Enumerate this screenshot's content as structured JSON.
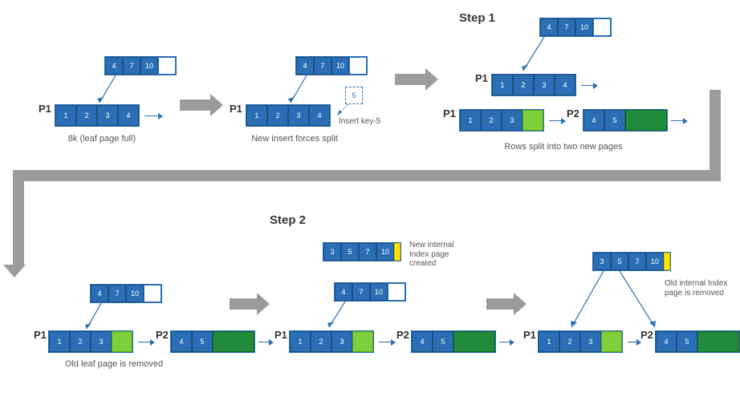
{
  "steps": {
    "s1": "Step 1",
    "s2": "Step 2"
  },
  "labels": {
    "p1": "P1",
    "p2": "P2"
  },
  "captions": {
    "c1": "8k (leaf page full)",
    "c2": "New insert forces split",
    "c3": "Rows split into two new pages",
    "c4": "Old leaf page is removed",
    "c5": "New internal Index page created",
    "c6": "Old internal Index page is removed"
  },
  "annot": {
    "ins": "Insert key-5"
  },
  "idx_a": {
    "v0": "4",
    "v1": "7",
    "v2": "10"
  },
  "idx_b": {
    "v0": "3",
    "v1": "5",
    "v2": "7",
    "v3": "10"
  },
  "leaf_full": {
    "v0": "1",
    "v1": "2",
    "v2": "3",
    "v3": "4"
  },
  "leaf_p1": {
    "v0": "1",
    "v1": "2",
    "v2": "3"
  },
  "leaf_p2": {
    "v0": "4",
    "v1": "5"
  },
  "ins_key": "5"
}
